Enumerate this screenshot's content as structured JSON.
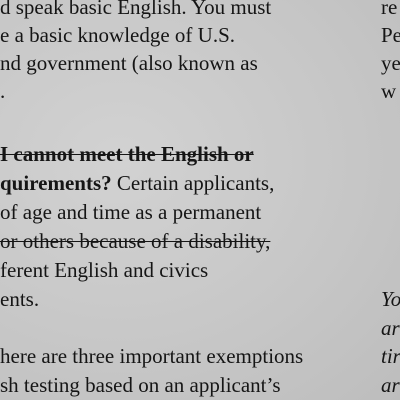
{
  "left_column": {
    "para1": [
      "d speak basic English. You must",
      "e a basic knowledge of U.S.",
      "nd government (also known as",
      "."
    ],
    "para2_line1": "I cannot meet the English or",
    "para2_line2_bold": "quirements?",
    "para2_line2_rest": " Certain applicants,",
    "para2_line3": "of age and time as a permanent",
    "para2_line4": " or others because of a disability,",
    "para2_line5": "ferent English and civics",
    "para2_line6": "ents.",
    "para3": [
      "here are three important exemptions",
      "sh testing based on an applicant’s"
    ]
  },
  "right_column": {
    "lines": [
      "re",
      "Pe",
      "ye",
      "w"
    ],
    "italic_lines": [
      "Yo",
      "ar",
      "tir",
      "ar"
    ]
  }
}
